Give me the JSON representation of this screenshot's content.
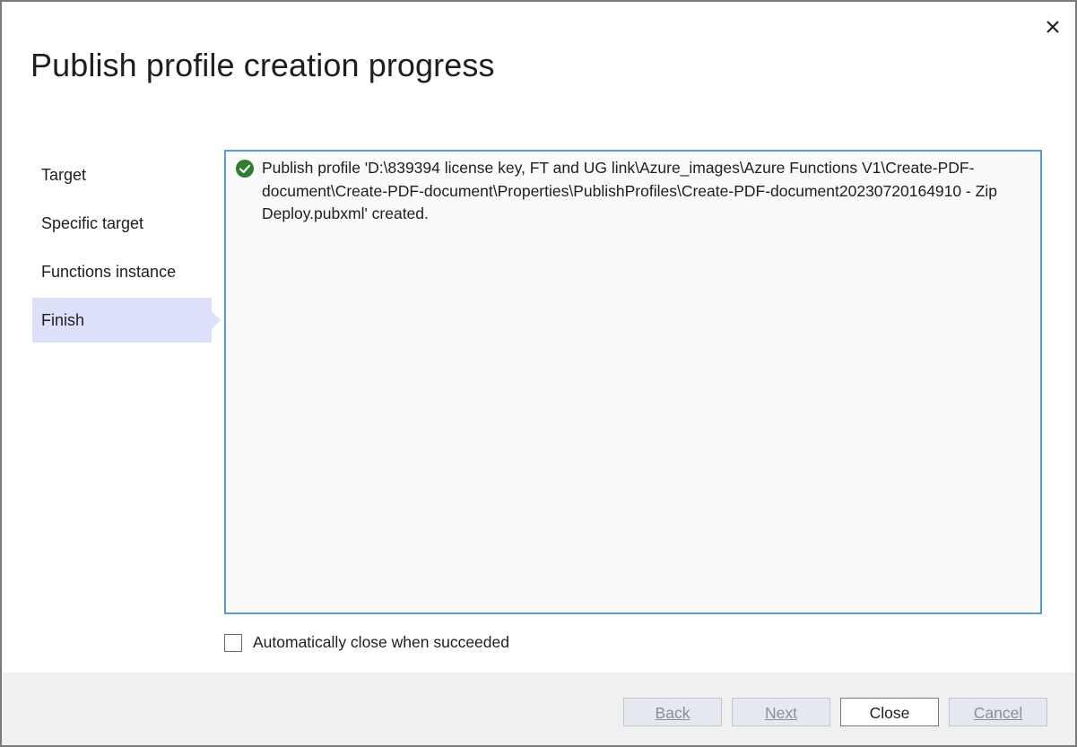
{
  "dialog": {
    "title": "Publish profile creation progress",
    "close_icon": "close-icon"
  },
  "sidebar": {
    "items": [
      {
        "label": "Target",
        "active": false
      },
      {
        "label": "Specific target",
        "active": false
      },
      {
        "label": "Functions instance",
        "active": false
      },
      {
        "label": "Finish",
        "active": true
      }
    ]
  },
  "output": {
    "status_icon": "success-check-icon",
    "status_color": "#2e7d32",
    "message": "Publish profile 'D:\\839394 license key, FT and UG link\\Azure_images\\Azure Functions V1\\Create-PDF-document\\Create-PDF-document\\Properties\\PublishProfiles\\Create-PDF-document20230720164910 - Zip Deploy.pubxml' created."
  },
  "options": {
    "auto_close_label": "Automatically close when succeeded",
    "auto_close_checked": false
  },
  "footer": {
    "back_label": "Back",
    "next_label": "Next",
    "close_label": "Close",
    "cancel_label": "Cancel"
  },
  "colors": {
    "accent_border": "#5a9bd5",
    "selected_nav": "#dce0f8",
    "footer_bg": "#f0f0f0"
  }
}
